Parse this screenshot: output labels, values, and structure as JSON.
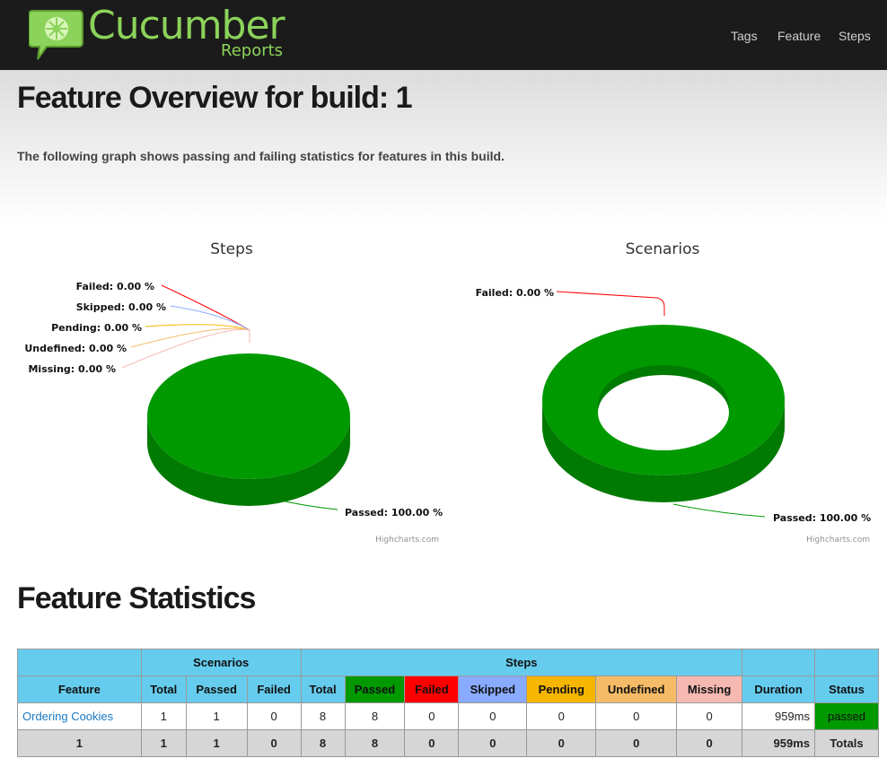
{
  "header": {
    "logo_title": "Cucumber",
    "logo_subtitle": "Reports",
    "logo_icon": "cucumber-speech-bubble-icon",
    "nav": {
      "tags": "Tags",
      "feature": "Feature",
      "steps": "Steps"
    }
  },
  "page": {
    "title": "Feature Overview for build: 1",
    "description": "The following graph shows passing and failing statistics for features in this build."
  },
  "chart_data": [
    {
      "type": "pie",
      "title": "Steps",
      "credit": "Highcharts.com",
      "slices": [
        {
          "label": "Passed",
          "value": 100.0,
          "text": "Passed: 100.00 %",
          "color": "#009900"
        },
        {
          "label": "Failed",
          "value": 0.0,
          "text": "Failed: 0.00 %",
          "color": "#ff0000"
        },
        {
          "label": "Skipped",
          "value": 0.0,
          "text": "Skipped: 0.00 %",
          "color": "#88aaff"
        },
        {
          "label": "Pending",
          "value": 0.0,
          "text": "Pending: 0.00 %",
          "color": "#f6b600"
        },
        {
          "label": "Undefined",
          "value": 0.0,
          "text": "Undefined: 0.00 %",
          "color": "#f6bb66"
        },
        {
          "label": "Missing",
          "value": 0.0,
          "text": "Missing: 0.00 %",
          "color": "#f6b9b2"
        }
      ]
    },
    {
      "type": "pie",
      "title": "Scenarios",
      "credit": "Highcharts.com",
      "donut": true,
      "slices": [
        {
          "label": "Passed",
          "value": 100.0,
          "text": "Passed: 100.00 %",
          "color": "#009900"
        },
        {
          "label": "Failed",
          "value": 0.0,
          "text": "Failed: 0.00 %",
          "color": "#ff0000"
        }
      ]
    }
  ],
  "stats": {
    "title": "Feature Statistics",
    "group_headers": {
      "scenarios": "Scenarios",
      "steps": "Steps"
    },
    "columns": [
      "Feature",
      "Total",
      "Passed",
      "Failed",
      "Total",
      "Passed",
      "Failed",
      "Skipped",
      "Pending",
      "Undefined",
      "Missing",
      "Duration",
      "Status"
    ],
    "rows": [
      {
        "feature": "Ordering Cookies",
        "sc_total": "1",
        "sc_passed": "1",
        "sc_failed": "0",
        "st_total": "8",
        "st_passed": "8",
        "st_failed": "0",
        "st_skipped": "0",
        "st_pending": "0",
        "st_undefined": "0",
        "st_missing": "0",
        "duration": "959ms",
        "status": "passed"
      }
    ],
    "totals": {
      "feature": "1",
      "sc_total": "1",
      "sc_passed": "1",
      "sc_failed": "0",
      "st_total": "8",
      "st_passed": "8",
      "st_failed": "0",
      "st_skipped": "0",
      "st_pending": "0",
      "st_undefined": "0",
      "st_missing": "0",
      "duration": "959ms",
      "status": "Totals"
    }
  }
}
